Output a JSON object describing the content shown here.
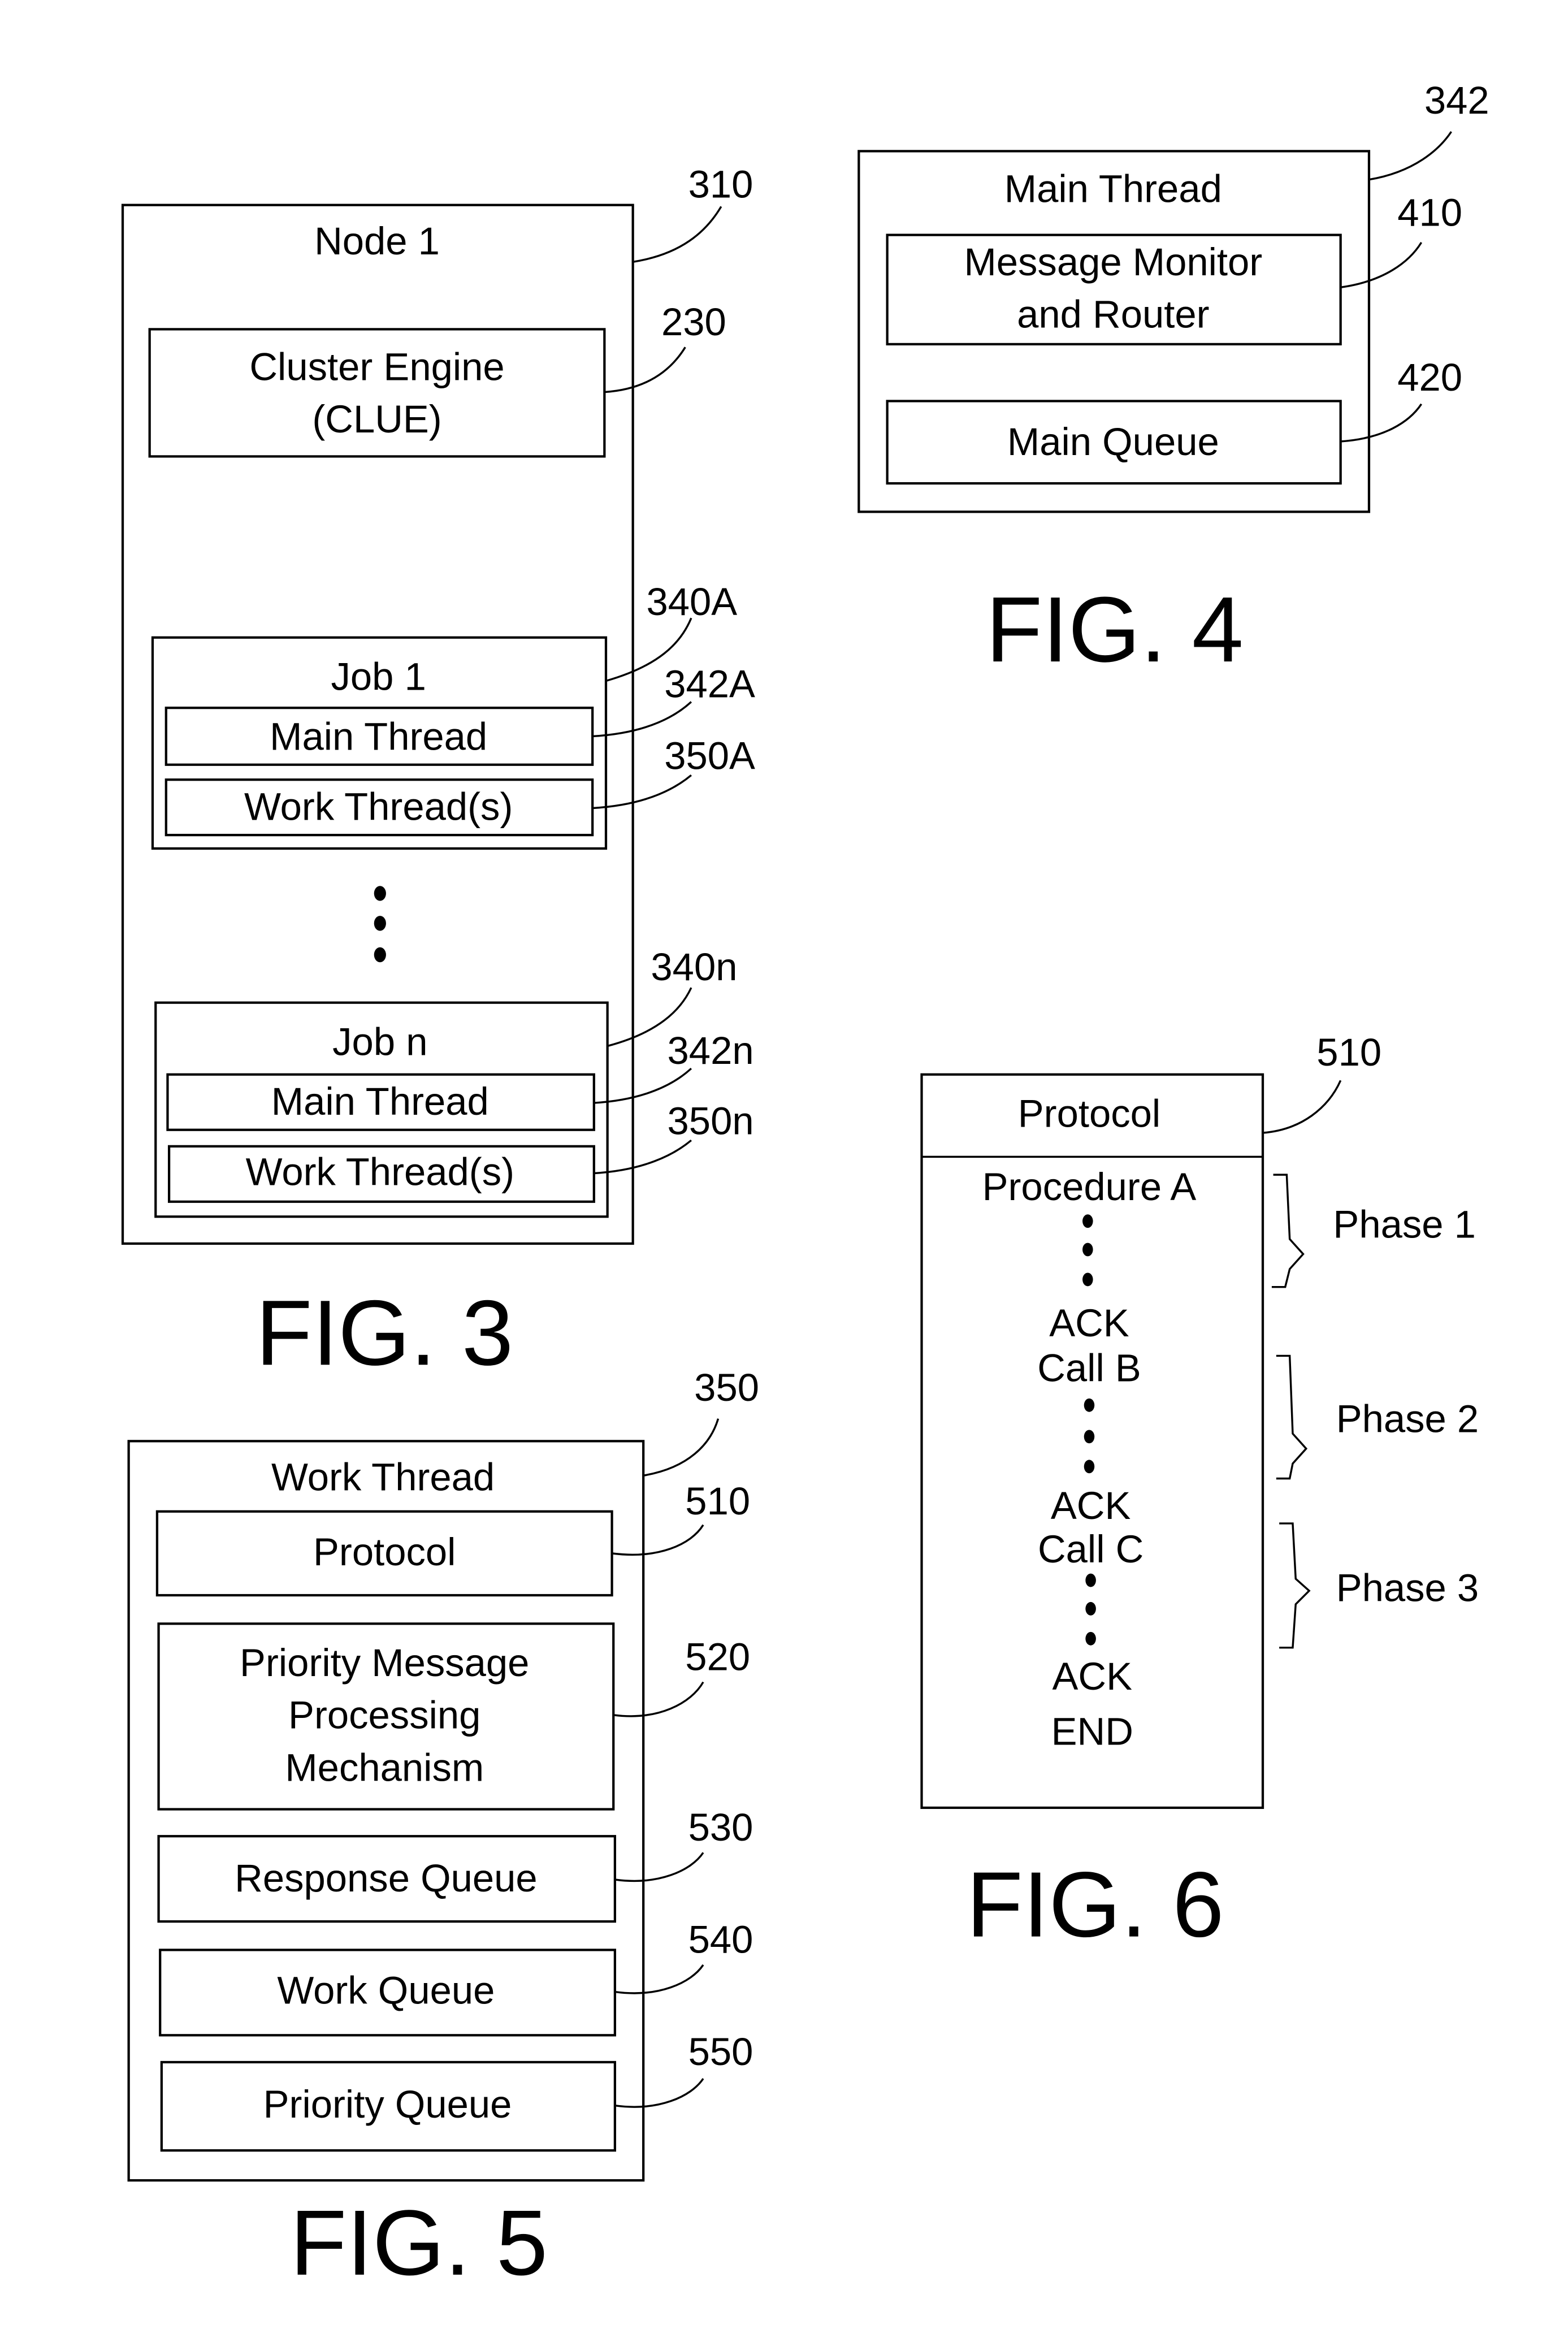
{
  "fig3": {
    "caption": "FIG. 3",
    "node": {
      "label": "Node 1",
      "ref": "310"
    },
    "cluster_engine": {
      "line1": "Cluster Engine",
      "line2": "(CLUE)",
      "ref": "230"
    },
    "job_first": {
      "label": "Job 1",
      "ref": "340A",
      "main_thread": {
        "label": "Main Thread",
        "ref": "342A"
      },
      "work_threads": {
        "label": "Work Thread(s)",
        "ref": "350A"
      }
    },
    "job_last": {
      "label": "Job n",
      "ref": "340n",
      "main_thread": {
        "label": "Main Thread",
        "ref": "342n"
      },
      "work_threads": {
        "label": "Work Thread(s)",
        "ref": "350n"
      }
    }
  },
  "fig4": {
    "caption": "FIG. 4",
    "main_thread": {
      "label": "Main Thread",
      "ref": "342"
    },
    "monitor_router": {
      "line1": "Message Monitor",
      "line2": "and Router",
      "ref": "410"
    },
    "main_queue": {
      "label": "Main Queue",
      "ref": "420"
    }
  },
  "fig5": {
    "caption": "FIG. 5",
    "work_thread": {
      "label": "Work Thread",
      "ref": "350"
    },
    "protocol": {
      "label": "Protocol",
      "ref": "510"
    },
    "priority_mechanism": {
      "line1": "Priority Message",
      "line2": "Processing",
      "line3": "Mechanism",
      "ref": "520"
    },
    "response_queue": {
      "label": "Response Queue",
      "ref": "530"
    },
    "work_queue": {
      "label": "Work Queue",
      "ref": "540"
    },
    "priority_queue": {
      "label": "Priority Queue",
      "ref": "550"
    }
  },
  "fig6": {
    "caption": "FIG. 6",
    "protocol": {
      "label": "Protocol",
      "ref": "510"
    },
    "steps": {
      "procedure_a": "Procedure A",
      "ack1": "ACK",
      "call_b": "Call B",
      "ack2": "ACK",
      "call_c": "Call C",
      "ack3": "ACK",
      "end": "END"
    },
    "phases": [
      "Phase 1",
      "Phase 2",
      "Phase 3"
    ]
  }
}
